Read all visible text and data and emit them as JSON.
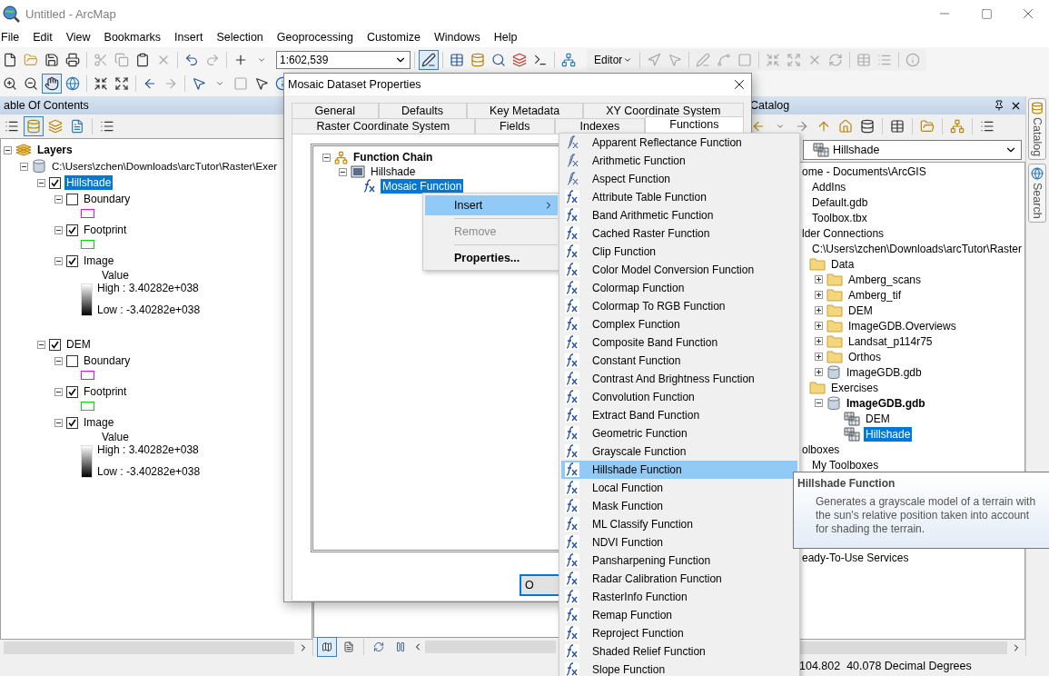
{
  "window": {
    "title": "Untitled - ArcMap"
  },
  "menu": [
    "File",
    "Edit",
    "View",
    "Bookmarks",
    "Insert",
    "Selection",
    "Geoprocessing",
    "Customize",
    "Windows",
    "Help"
  ],
  "toolbar": {
    "scale": "1:602,539",
    "editor": "Editor"
  },
  "toc": {
    "title": "able Of Contents",
    "root": "Layers",
    "path": "C:\\Users\\zchen\\Downloads\\arcTutor\\Raster\\Exer",
    "layers": [
      {
        "name": "Hillshade",
        "checked": true,
        "selected": true,
        "children": [
          {
            "name": "Boundary",
            "kind": "outline",
            "checked": false,
            "color": "#ff00ff"
          },
          {
            "name": "Footprint",
            "kind": "outline",
            "checked": true,
            "color": "#00dd00"
          },
          {
            "name": "Image",
            "kind": "raster",
            "checked": true,
            "heading": "Value",
            "high": "High : 3.40282e+038",
            "low": "Low : -3.40282e+038"
          }
        ]
      },
      {
        "name": "DEM",
        "checked": true,
        "selected": false,
        "children": [
          {
            "name": "Boundary",
            "kind": "outline",
            "checked": false,
            "color": "#ff00ff"
          },
          {
            "name": "Footprint",
            "kind": "outline",
            "checked": true,
            "color": "#00dd00"
          },
          {
            "name": "Image",
            "kind": "raster",
            "checked": true,
            "heading": "Value",
            "high": "High : 3.40282e+038",
            "low": "Low : -3.40282e+038"
          }
        ]
      }
    ]
  },
  "catalog": {
    "title": "Catalog",
    "location": "Hillshade",
    "tree": [
      {
        "label": "ome - Documents\\ArcGIS",
        "children": [
          {
            "label": "AddIns"
          },
          {
            "label": "Default.gdb"
          },
          {
            "label": "Toolbox.tbx"
          }
        ]
      },
      {
        "label": "lder Connections",
        "children": [
          {
            "label": "C:\\Users\\zchen\\Downloads\\arcTutor\\Raster",
            "children": [
              {
                "label": "Data",
                "kind": "folder",
                "children": [
                  {
                    "label": "Amberg_scans",
                    "kind": "folder",
                    "expanded": false
                  },
                  {
                    "label": "Amberg_tif",
                    "kind": "folder",
                    "expanded": false
                  },
                  {
                    "label": "DEM",
                    "kind": "folder",
                    "expanded": false
                  },
                  {
                    "label": "ImageGDB.Overviews",
                    "kind": "folder",
                    "expanded": false
                  },
                  {
                    "label": "Landsat_p114r75",
                    "kind": "folder",
                    "expanded": false
                  },
                  {
                    "label": "Orthos",
                    "kind": "folder",
                    "expanded": false
                  },
                  {
                    "label": "ImageGDB.gdb",
                    "kind": "database",
                    "expanded": false
                  }
                ]
              },
              {
                "label": "Exercises",
                "kind": "folder",
                "children": [
                  {
                    "label": "ImageGDB.gdb",
                    "kind": "database",
                    "expanded": true,
                    "bold": true,
                    "children": [
                      {
                        "label": "DEM",
                        "kind": "raster",
                        "selected": false
                      },
                      {
                        "label": "Hillshade",
                        "kind": "raster",
                        "selected": true
                      }
                    ]
                  }
                ]
              }
            ]
          }
        ]
      },
      {
        "label": "olboxes",
        "children": [
          {
            "label": "My Toolboxes"
          }
        ]
      },
      {
        "label": "eady-To-Use Services"
      }
    ]
  },
  "side_tabs": [
    "Catalog",
    "Search"
  ],
  "status": "104.802  40.078 Decimal Degrees",
  "dialog": {
    "title": "Mosaic Dataset Properties",
    "tab_rows": [
      [
        {
          "label": "General",
          "selected": false
        },
        {
          "label": "Defaults",
          "selected": false
        },
        {
          "label": "Key Metadata",
          "selected": false
        },
        {
          "label": "XY Coordinate System",
          "selected": false
        }
      ],
      [
        {
          "label": "Raster Coordinate System",
          "selected": false
        },
        {
          "label": "Fields",
          "selected": false
        },
        {
          "label": "Indexes",
          "selected": false
        },
        {
          "label": "Functions",
          "selected": true
        }
      ]
    ],
    "chain": {
      "label": "Function Chain",
      "children": [
        {
          "label": "Hillshade",
          "children": [
            {
              "label": "Mosaic Function",
              "selected": true
            }
          ]
        }
      ]
    },
    "button": "O"
  },
  "context_menu": [
    {
      "label": "Insert",
      "selected": true,
      "disabled": false,
      "submenu": true
    },
    {
      "label": "Remove",
      "selected": false,
      "disabled": true
    },
    {
      "label": "Properties...",
      "selected": false,
      "disabled": false,
      "bold": true
    }
  ],
  "submenu": [
    {
      "label": "Apparent Reflectance Function",
      "kind": "stacked",
      "selected": false
    },
    {
      "label": "Arithmetic Function",
      "kind": "stacked",
      "selected": false
    },
    {
      "label": "Aspect Function",
      "kind": "stacked",
      "selected": false
    },
    {
      "label": "Attribute Table Function",
      "kind": "single",
      "selected": false
    },
    {
      "label": "Band Arithmetic Function",
      "kind": "single",
      "selected": false
    },
    {
      "label": "Cached Raster Function",
      "kind": "single",
      "selected": false
    },
    {
      "label": "Clip Function",
      "kind": "single",
      "selected": false
    },
    {
      "label": "Color Model Conversion Function",
      "kind": "single",
      "selected": false
    },
    {
      "label": "Colormap Function",
      "kind": "single",
      "selected": false
    },
    {
      "label": "Colormap To RGB Function",
      "kind": "single",
      "selected": false
    },
    {
      "label": "Complex Function",
      "kind": "single",
      "selected": false
    },
    {
      "label": "Composite Band Function",
      "kind": "single",
      "selected": false
    },
    {
      "label": "Constant Function",
      "kind": "single",
      "selected": false
    },
    {
      "label": "Contrast And Brightness Function",
      "kind": "single",
      "selected": false
    },
    {
      "label": "Convolution Function",
      "kind": "single",
      "selected": false
    },
    {
      "label": "Extract Band Function",
      "kind": "single",
      "selected": false
    },
    {
      "label": "Geometric Function",
      "kind": "single",
      "selected": false
    },
    {
      "label": "Grayscale Function",
      "kind": "single",
      "selected": false
    },
    {
      "label": "Hillshade Function",
      "kind": "single",
      "selected": true
    },
    {
      "label": "Local Function",
      "kind": "single",
      "selected": false
    },
    {
      "label": "Mask Function",
      "kind": "single",
      "selected": false
    },
    {
      "label": "ML Classify Function",
      "kind": "single",
      "selected": false
    },
    {
      "label": "NDVI Function",
      "kind": "single",
      "selected": false
    },
    {
      "label": "Pansharpening Function",
      "kind": "single",
      "selected": false
    },
    {
      "label": "Radar Calibration Function",
      "kind": "single",
      "selected": false
    },
    {
      "label": "RasterInfo Function",
      "kind": "single",
      "selected": false
    },
    {
      "label": "Remap Function",
      "kind": "single",
      "selected": false
    },
    {
      "label": "Reproject Function",
      "kind": "single",
      "selected": false
    },
    {
      "label": "Shaded Relief Function",
      "kind": "single",
      "selected": false
    },
    {
      "label": "Slope Function",
      "kind": "single",
      "selected": false
    }
  ],
  "tooltip": {
    "title": "Hillshade Function",
    "text": "Generates a grayscale model of a terrain with the sun's relative position taken into account for shading the terrain."
  }
}
